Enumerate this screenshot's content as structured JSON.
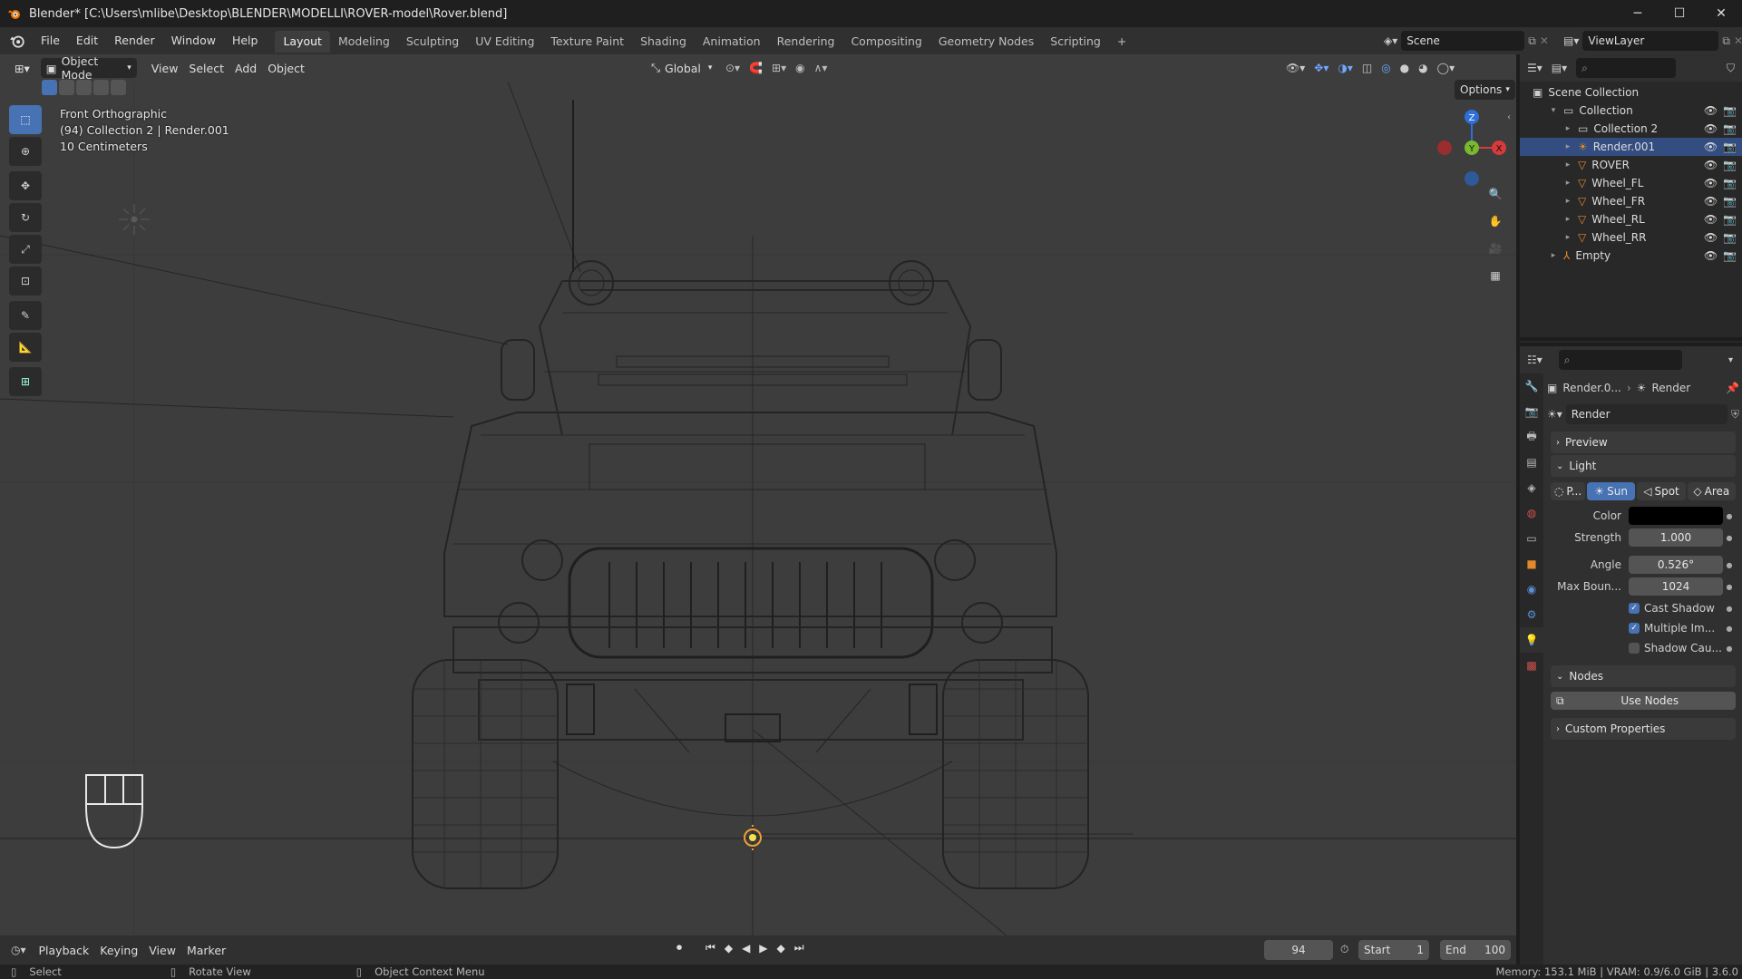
{
  "window": {
    "title": "Blender* [C:\\Users\\mlibe\\Desktop\\BLENDER\\MODELLI\\ROVER-model\\Rover.blend]",
    "min": "─",
    "max": "☐",
    "close": "✕"
  },
  "menu": {
    "items": [
      "File",
      "Edit",
      "Render",
      "Window",
      "Help"
    ],
    "workspaces": [
      "Layout",
      "Modeling",
      "Sculpting",
      "UV Editing",
      "Texture Paint",
      "Shading",
      "Animation",
      "Rendering",
      "Compositing",
      "Geometry Nodes",
      "Scripting"
    ],
    "add_ws": "+",
    "scene": "Scene",
    "view_layer": "ViewLayer"
  },
  "viewport": {
    "mode": "Object Mode",
    "menus": [
      "View",
      "Select",
      "Add",
      "Object"
    ],
    "orientation": "Global",
    "options": "Options",
    "view_name": "Front Orthographic",
    "collection_info": "(94) Collection 2 | Render.001",
    "scale": "10 Centimeters",
    "gizmo": {
      "z": "Z",
      "y": "Y",
      "x": "X"
    }
  },
  "outliner": {
    "scene_collection": "Scene Collection",
    "items": [
      {
        "name": "Collection",
        "depth": 1,
        "expanded": true,
        "type": "collection"
      },
      {
        "name": "Collection 2",
        "depth": 2,
        "type": "collection"
      },
      {
        "name": "Render.001",
        "depth": 2,
        "type": "light",
        "selected": true
      },
      {
        "name": "ROVER",
        "depth": 2,
        "type": "mesh"
      },
      {
        "name": "Wheel_FL",
        "depth": 2,
        "type": "mesh"
      },
      {
        "name": "Wheel_FR",
        "depth": 2,
        "type": "mesh"
      },
      {
        "name": "Wheel_RL",
        "depth": 2,
        "type": "mesh"
      },
      {
        "name": "Wheel_RR",
        "depth": 2,
        "type": "mesh"
      },
      {
        "name": "Empty",
        "depth": 1,
        "type": "empty"
      }
    ]
  },
  "properties": {
    "breadcrumb_object": "Render.0...",
    "breadcrumb_data": "Render",
    "datablock": "Render",
    "panels": {
      "preview": "Preview",
      "light": "Light",
      "nodes": "Nodes",
      "custom": "Custom Properties"
    },
    "light_types": [
      "P...",
      "Sun",
      "Spot",
      "Area"
    ],
    "active_light_type": "Sun",
    "color_label": "Color",
    "color_value": "#000000",
    "strength_label": "Strength",
    "strength": "1.000",
    "angle_label": "Angle",
    "angle": "0.526°",
    "bounces_label": "Max Boun...",
    "bounces": "1024",
    "cast_shadow": "Cast Shadow",
    "multiple_importance": "Multiple Im...",
    "shadow_caustics": "Shadow Cau...",
    "use_nodes": "Use Nodes"
  },
  "timeline": {
    "menus": [
      "Playback",
      "Keying",
      "View",
      "Marker"
    ],
    "current_frame": "94",
    "start_label": "Start",
    "start": "1",
    "end_label": "End",
    "end": "100"
  },
  "status": {
    "select": "Select",
    "rotate": "Rotate View",
    "context": "Object Context Menu",
    "memory": "Memory: 153.1 MiB | VRAM: 0.9/6.0 GiB | 3.6.0"
  }
}
